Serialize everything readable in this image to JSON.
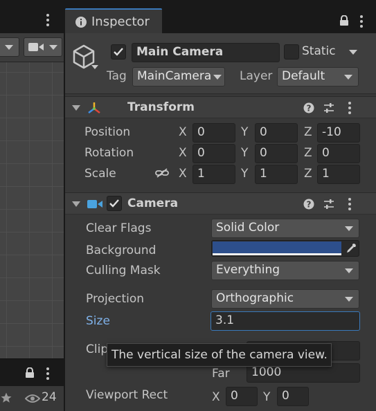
{
  "colors": {
    "accent": "#3a79bb",
    "background_swatch": "#2d4f8c",
    "camera_icon": "#4aa3df",
    "transform_x": "#e0473a",
    "transform_y": "#6fc04f",
    "transform_z": "#3e8ee6"
  },
  "left_panel": {
    "stat_count": "24"
  },
  "inspector": {
    "tab_title": "Inspector",
    "object": {
      "name": "Main Camera",
      "static_label": "Static",
      "tag_label": "Tag",
      "tag_value": "MainCamera",
      "layer_label": "Layer",
      "layer_value": "Default",
      "active": true
    },
    "transform": {
      "title": "Transform",
      "position_label": "Position",
      "rotation_label": "Rotation",
      "scale_label": "Scale",
      "axis_x": "X",
      "axis_y": "Y",
      "axis_z": "Z",
      "position": {
        "x": "0",
        "y": "0",
        "z": "-10"
      },
      "rotation": {
        "x": "0",
        "y": "0",
        "z": "0"
      },
      "scale": {
        "x": "1",
        "y": "1",
        "z": "1"
      }
    },
    "camera": {
      "title": "Camera",
      "clear_flags_label": "Clear Flags",
      "clear_flags_value": "Solid Color",
      "background_label": "Background",
      "culling_mask_label": "Culling Mask",
      "culling_mask_value": "Everything",
      "projection_label": "Projection",
      "projection_value": "Orthographic",
      "size_label": "Size",
      "size_value": "3.1",
      "clipping_label": "Clip",
      "far_label": "Far",
      "far_value": "1000",
      "viewport_label": "Viewport Rect",
      "viewport_x_label": "X",
      "viewport_x": "0",
      "viewport_y_label": "Y",
      "viewport_y": "0"
    },
    "tooltip": "The vertical size of the camera view."
  }
}
